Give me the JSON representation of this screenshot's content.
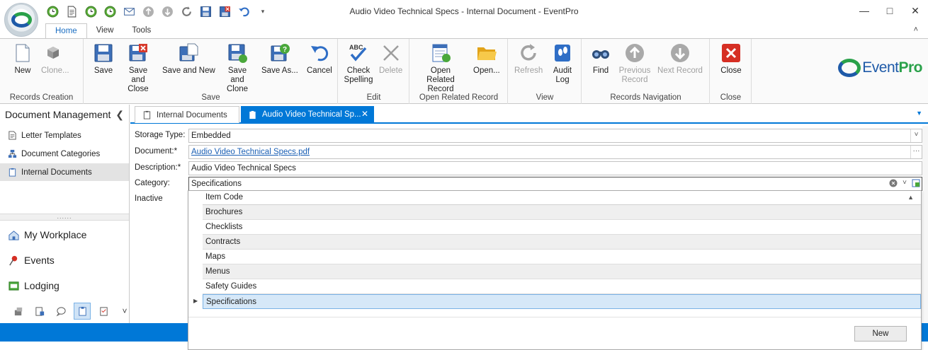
{
  "window": {
    "title": "Audio Video Technical Specs - Internal Document - EventPro",
    "minimize": "—",
    "maximize": "□",
    "close": "✕"
  },
  "ribbon_tabs": [
    "Home",
    "View",
    "Tools"
  ],
  "ribbon_collapse": "˄",
  "ribbon": {
    "groups": {
      "records_creation": "Records Creation",
      "save": "Save",
      "edit": "Edit",
      "open_related": "Open Related Record",
      "view": "View",
      "records_navigation": "Records Navigation",
      "close": "Close"
    },
    "buttons": {
      "new": "New",
      "clone": "Clone...",
      "save": "Save",
      "save_and_close": "Save and Close",
      "save_and_new": "Save and New",
      "save_and_clone": "Save and Clone",
      "save_as": "Save As...",
      "cancel": "Cancel",
      "check_spelling": "Check Spelling",
      "delete": "Delete",
      "open_related_record": "Open Related Record",
      "open": "Open...",
      "refresh": "Refresh",
      "audit_log": "Audit Log",
      "find": "Find",
      "previous_record": "Previous Record",
      "next_record": "Next Record",
      "close": "Close"
    },
    "brand": {
      "event": "Event",
      "pro": "Pro"
    }
  },
  "navpane": {
    "title": "Document Management",
    "collapse": "❮",
    "items": [
      "Letter Templates",
      "Document Categories",
      "Internal Documents"
    ],
    "splitter": "......",
    "modules": [
      "My Workplace",
      "Events",
      "Lodging"
    ],
    "more": "˅"
  },
  "doc_tabs": {
    "inactive": "Internal Documents",
    "active": "Audio Video Technical Sp...",
    "close": "✕",
    "dropdown": "▼"
  },
  "form": {
    "storage_type_label": "Storage Type:",
    "storage_type_value": "Embedded",
    "document_label": "Document:*",
    "document_value": "Audio Video Technical Specs.pdf",
    "description_label": "Description:*",
    "description_value": "Audio Video Technical Specs",
    "category_label": "Category:",
    "category_value": "Specifications",
    "inactive_label": "Inactive",
    "ellipsis": "···",
    "dropdown_arrow": "˅"
  },
  "category_popup": {
    "column_header": "Item Code",
    "sort_indicator": "▲",
    "rows": [
      "Brochures",
      "Checklists",
      "Contracts",
      "Maps",
      "Menus",
      "Safety Guides",
      "Specifications"
    ],
    "selected_index": 6,
    "row_indicator": "▶",
    "new_button": "New"
  },
  "colors": {
    "accent": "#0078d7",
    "brand_blue": "#1e5aa8",
    "brand_green": "#2aa14a"
  }
}
